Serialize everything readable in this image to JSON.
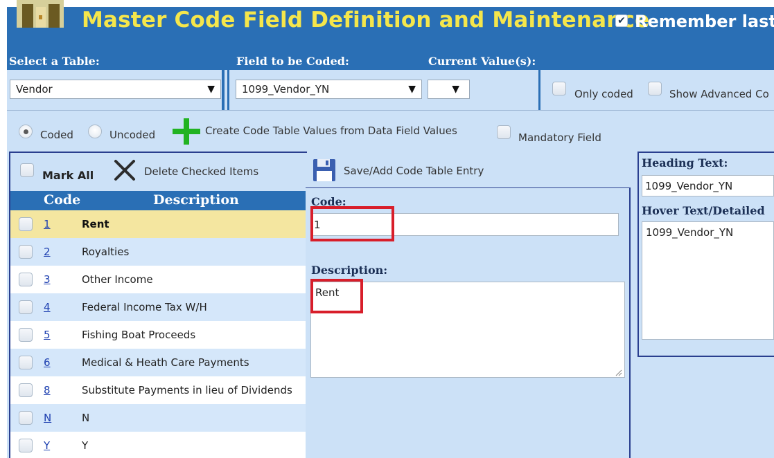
{
  "header": {
    "title": "Master Code Field Definition and Maintenance",
    "remember_label": "Remember last",
    "remember_checked": true
  },
  "selectors": {
    "table_label": "Select a Table:",
    "table_value": "Vendor",
    "field_label": "Field to be Coded:",
    "field_value": "1099_Vendor_YN",
    "current_label": "Current Value(s):",
    "current_value": "",
    "only_coded_label": "Only coded",
    "show_advanced_label": "Show Advanced Co"
  },
  "options": {
    "coded_label": "Coded",
    "uncoded_label": "Uncoded",
    "selected": "Coded",
    "create_label": "Create Code Table Values from Data Field Values",
    "mandatory_label": "Mandatory Field"
  },
  "toolbar": {
    "mark_all_label": "Mark All",
    "delete_label": "Delete Checked Items",
    "save_label": "Save/Add Code Table Entry"
  },
  "table": {
    "headers": [
      "Code",
      "Description"
    ],
    "rows": [
      {
        "code": "1",
        "description": "Rent",
        "selected": true
      },
      {
        "code": "2",
        "description": "Royalties"
      },
      {
        "code": "3",
        "description": "Other Income"
      },
      {
        "code": "4",
        "description": "Federal Income Tax W/H"
      },
      {
        "code": "5",
        "description": "Fishing Boat Proceeds"
      },
      {
        "code": "6",
        "description": "Medical & Heath Care Payments"
      },
      {
        "code": "8",
        "description": "Substitute Payments in lieu of Dividends"
      },
      {
        "code": "N",
        "description": "N"
      },
      {
        "code": "Y",
        "description": "Y"
      }
    ]
  },
  "editor": {
    "code_label": "Code:",
    "code_value": "1",
    "description_label": "Description:",
    "description_value": "Rent"
  },
  "right_panel": {
    "heading_label": "Heading Text:",
    "heading_value": "1099_Vendor_YN",
    "hover_label": "Hover Text/Detailed",
    "hover_value": "1099_Vendor_YN"
  },
  "colors": {
    "header_blue": "#2a6fb5",
    "title_yellow": "#f5e64b",
    "panel_bg": "#cce1f7",
    "selected_row": "#f4e6a0",
    "highlight_red": "#d81e2a",
    "add_green": "#22b322"
  },
  "icons": {
    "logo": "app-logo-icon",
    "create": "plus-icon",
    "delete": "x-icon",
    "save": "floppy-disk-icon"
  }
}
